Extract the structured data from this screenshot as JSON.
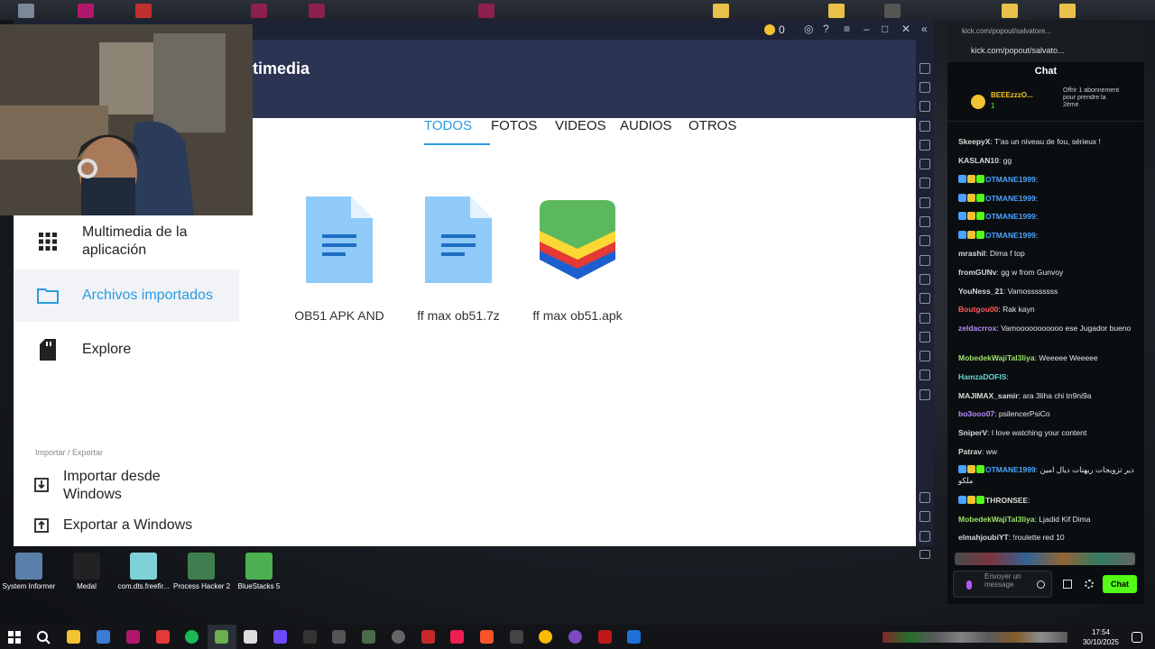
{
  "bluestacks": {
    "coins": "0",
    "header_title": "timedia",
    "tabs": [
      {
        "label": "TODOS",
        "active": true
      },
      {
        "label": "FOTOS",
        "active": false
      },
      {
        "label": "VIDEOS",
        "active": false
      },
      {
        "label": "AUDIOS",
        "active": false
      },
      {
        "label": "OTROS",
        "active": false
      }
    ],
    "files": [
      {
        "name": "OB51 APK AND",
        "icon": "document-icon"
      },
      {
        "name": "ff max ob51.7z",
        "icon": "document-icon"
      },
      {
        "name": "ff max ob51.apk",
        "icon": "bluestacks-icon"
      }
    ]
  },
  "drawer": {
    "items": [
      {
        "label": "Multimedia de la aplicación",
        "icon": "grid-icon"
      },
      {
        "label": "Archivos importados",
        "icon": "folder-icon"
      },
      {
        "label": "Explore",
        "icon": "sd-card-icon"
      }
    ],
    "section": "Importar / Exportar",
    "actions": [
      {
        "label": "Importar desde Windows",
        "icon": "import-icon"
      },
      {
        "label": "Exportar a Windows",
        "icon": "export-icon"
      }
    ]
  },
  "chat": {
    "url": "kick.com/popout/salvato...",
    "tab_title": "kick.com/popout/salvatore...",
    "header": "Chat",
    "pinned": {
      "user": "BEEEzzzO...",
      "count": "1",
      "text": "Offrir 1 abonnement pour prendre la 2ème"
    },
    "messages": [
      {
        "user": "SkeepyX",
        "color": "#d9d9d9",
        "text": "T'as un niveau de fou, sérieux !"
      },
      {
        "user": "KASLAN10",
        "color": "#d9d9d9",
        "text": "gg"
      },
      {
        "user": "OTMANE1999",
        "color": "#4aa3ff",
        "text": ""
      },
      {
        "user": "OTMANE1999",
        "color": "#4aa3ff",
        "text": ""
      },
      {
        "user": "OTMANE1999",
        "color": "#4aa3ff",
        "text": ""
      },
      {
        "user": "OTMANE1999",
        "color": "#4aa3ff",
        "text": ""
      },
      {
        "user": "mrashil",
        "color": "#d9d9d9",
        "text": "Dima f top"
      },
      {
        "user": "fromGUNv",
        "color": "#d9d9d9",
        "text": "gg w from Gunvoy"
      },
      {
        "user": "YouNess_21",
        "color": "#d9d9d9",
        "text": "Vamossssssss"
      },
      {
        "user": "Boutgou00",
        "color": "#ff5c5c",
        "text": "Rak kayn"
      },
      {
        "user": "zeldacrrox",
        "color": "#b98bff",
        "text": "Vamooooooooooo ese Jugador bueno"
      },
      {
        "user": "MobedekWajiTal3liya",
        "color": "#9be36b",
        "text": "Weeeee Weeeee"
      },
      {
        "user": "HamzaDOFIS",
        "color": "#66d9d9",
        "text": ""
      },
      {
        "user": "MAJIMAX_samir",
        "color": "#d9d9d9",
        "text": "ara 3liha chi tn9ni9a"
      },
      {
        "user": "bo3ooo07",
        "color": "#b98bff",
        "text": "psilencerPsiCo"
      },
      {
        "user": "SniperV",
        "color": "#d9d9d9",
        "text": "I love watching your content"
      },
      {
        "user": "Patrav",
        "color": "#d9d9d9",
        "text": "ww"
      },
      {
        "user": "OTMANE1999",
        "color": "#4aa3ff",
        "text": "دير تزويجات ريهنات ديال امين ملكو"
      },
      {
        "user": "THRONSEE",
        "color": "#d9d9d9",
        "text": ""
      },
      {
        "user": "MobedekWajiTal3liya",
        "color": "#9be36b",
        "text": "Ljadid Kif Dima"
      },
      {
        "user": "elmahjoubiYT",
        "color": "#d9d9d9",
        "text": "!roulette red 10"
      }
    ],
    "input_placeholder": "Envoyer un message",
    "send_label": "Chat"
  },
  "desktop_icons": [
    {
      "label": "System Informer",
      "color": "#5a7fa8"
    },
    {
      "label": "Medal",
      "color": "#222222"
    },
    {
      "label": "com.dts.freefir...",
      "color": "#7fd0d8"
    },
    {
      "label": "Process Hacker 2",
      "color": "#3f7f4f"
    },
    {
      "label": "BlueStacks 5",
      "color": "#4caf50"
    }
  ],
  "clock": {
    "time": "17:54",
    "date": "30/10/2025"
  }
}
